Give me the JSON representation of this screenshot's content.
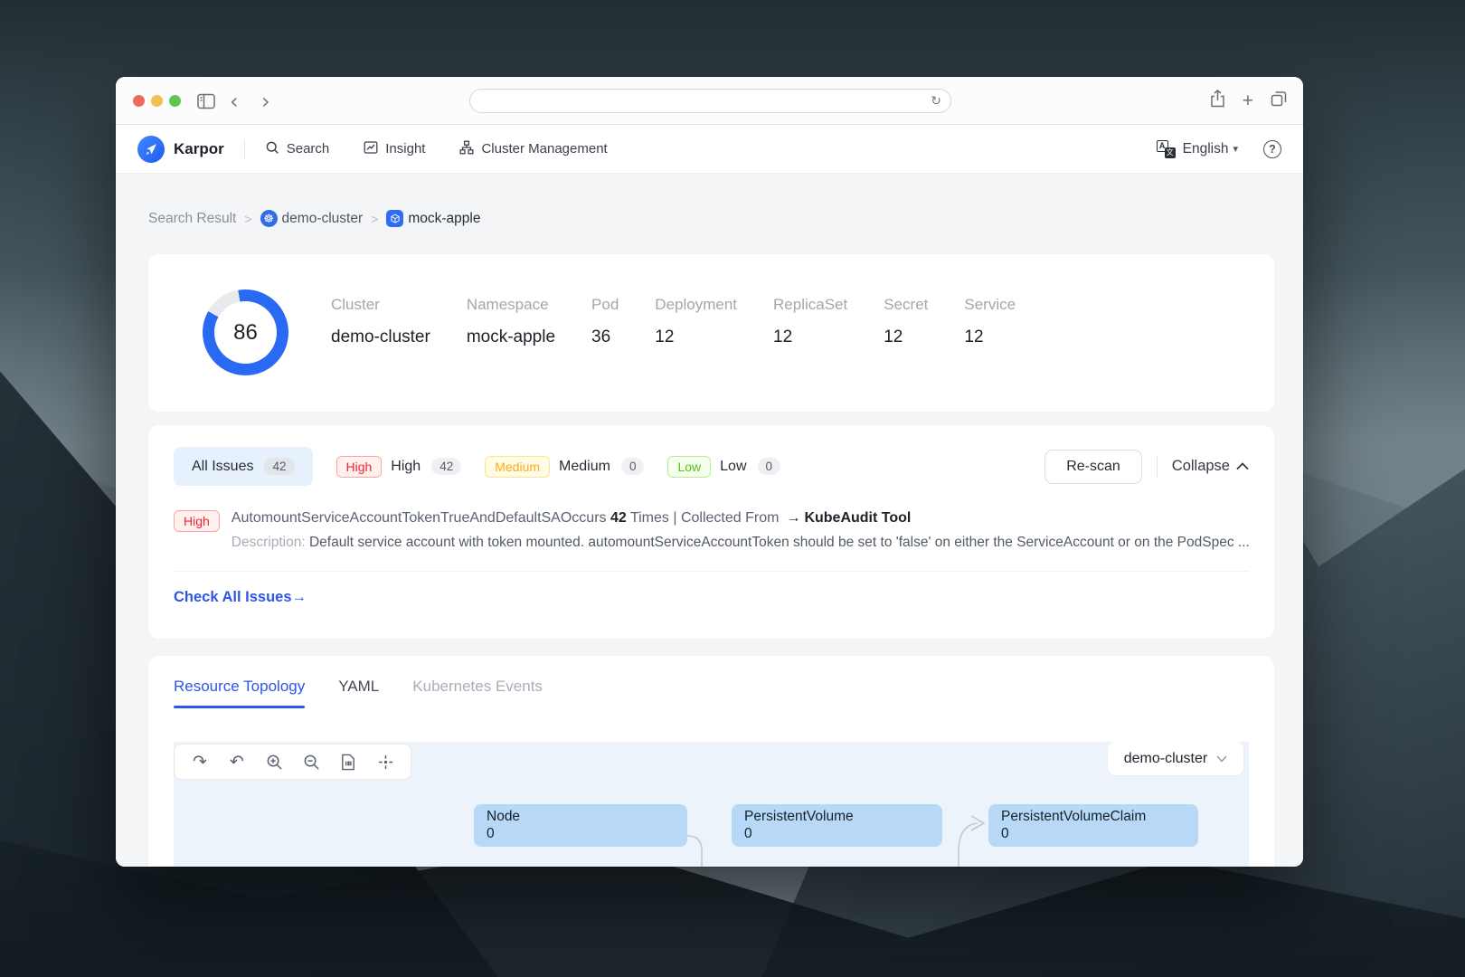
{
  "colors": {
    "accent": "#2e56ea",
    "score_ring": "#2a6af2",
    "k8s_blue": "#326de6",
    "node_fill": "#b7d9f7",
    "canvas_bg": "#edf3fa",
    "chip_bg": "#e7f0fd",
    "high": "#f5222d",
    "high_bg": "#fff1f0",
    "high_border": "#ffa39e",
    "medium": "#faad14",
    "medium_bg": "#fffbe6",
    "medium_border": "#ffe58f",
    "low": "#52c41a",
    "low_bg": "#f6ffed",
    "low_border": "#b7eb8f"
  },
  "icons": {
    "back": "‹",
    "forward": "›",
    "reload": "↻",
    "plus": "+",
    "caret_down": "▾",
    "arrow_right": "→",
    "redo": "↷",
    "undo": "↶",
    "k8s_wheel": "☸",
    "translate_a": "A",
    "translate_cjk": "文",
    "help": "?"
  },
  "browser": {
    "url": ""
  },
  "header": {
    "brand": "Karpor",
    "nav": [
      {
        "label": "Search"
      },
      {
        "label": "Insight"
      },
      {
        "label": "Cluster Management"
      }
    ],
    "language": "English"
  },
  "breadcrumb": {
    "root": "Search Result",
    "separator": ">",
    "cluster": "demo-cluster",
    "resource": "mock-apple"
  },
  "summary": {
    "score": "86",
    "stats": [
      {
        "label": "Cluster",
        "value": "demo-cluster"
      },
      {
        "label": "Namespace",
        "value": "mock-apple"
      },
      {
        "label": "Pod",
        "value": "36"
      },
      {
        "label": "Deployment",
        "value": "12"
      },
      {
        "label": "ReplicaSet",
        "value": "12"
      },
      {
        "label": "Secret",
        "value": "12"
      },
      {
        "label": "Service",
        "value": "12"
      }
    ]
  },
  "issues": {
    "all_label": "All Issues",
    "all_count": "42",
    "filters": [
      {
        "tag": "High",
        "label": "High",
        "count": "42"
      },
      {
        "tag": "Medium",
        "label": "Medium",
        "count": "0"
      },
      {
        "tag": "Low",
        "label": "Low",
        "count": "0"
      }
    ],
    "rescan_label": "Re-scan",
    "collapse_label": "Collapse",
    "item": {
      "severity": "High",
      "title": "AutomountServiceAccountTokenTrueAndDefaultSA",
      "occurs_label": "Occurs ",
      "occurs_count": "42",
      "times_label": " Times",
      "separator": " | ",
      "collected_label": "Collected From",
      "source": "KubeAudit Tool",
      "description_label": "Description: ",
      "description": "Default service account with token mounted. automountServiceAccountToken should be set to 'false' on either the ServiceAccount or on the PodSpec ..."
    },
    "check_all_label": "Check All Issues"
  },
  "tabs": [
    {
      "label": "Resource Topology"
    },
    {
      "label": "YAML"
    },
    {
      "label": "Kubernetes Events"
    }
  ],
  "topology": {
    "cluster_selector": "demo-cluster",
    "nodes": [
      {
        "title": "Node",
        "count": "0"
      },
      {
        "title": "PersistentVolume",
        "count": "0"
      },
      {
        "title": "PersistentVolumeClaim",
        "count": "0"
      }
    ]
  }
}
